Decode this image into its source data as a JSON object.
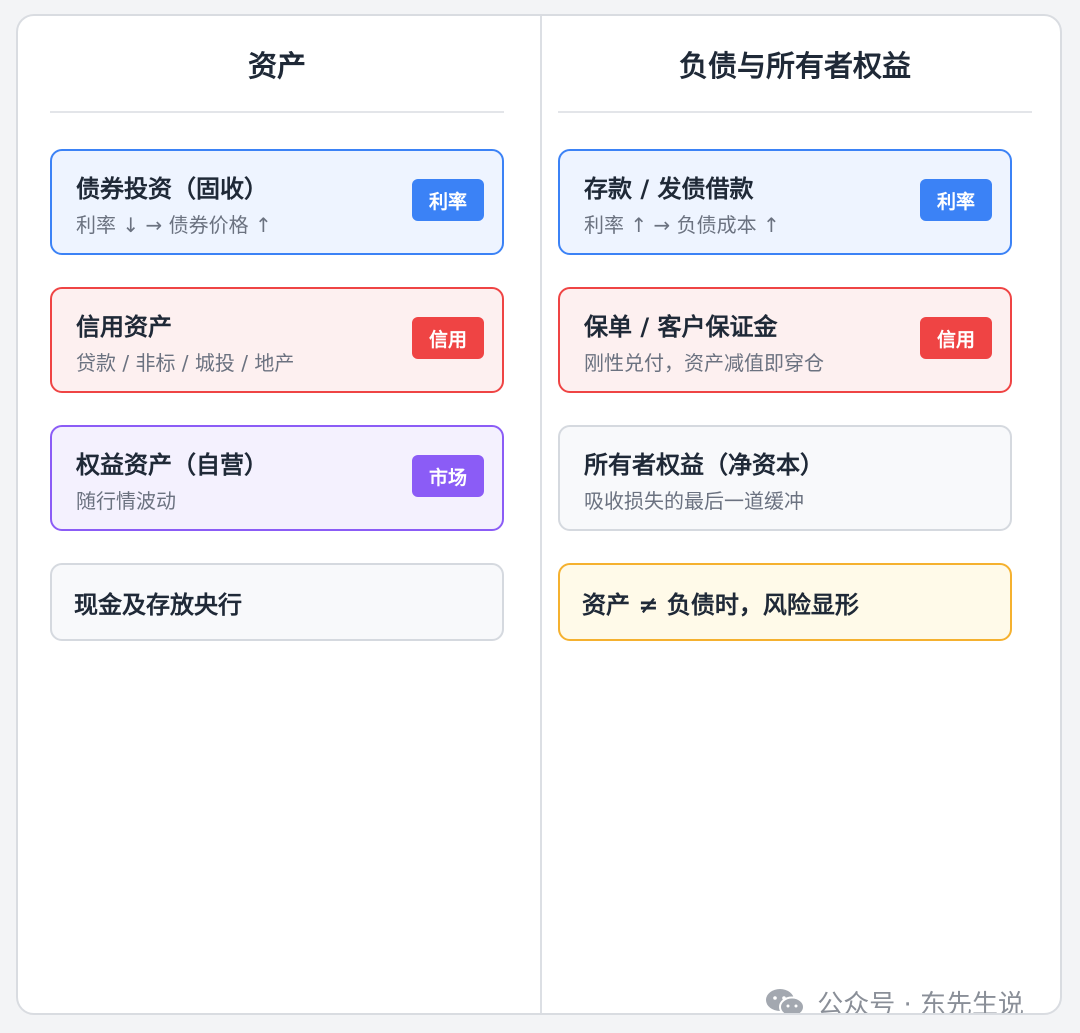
{
  "left": {
    "header": "资产",
    "cards": [
      {
        "title": "债券投资（固收）",
        "sub": "利率 ↓ → 债券价格 ↑",
        "badge": "利率"
      },
      {
        "title": "信用资产",
        "sub": "贷款 / 非标 / 城投 / 地产",
        "badge": "信用"
      },
      {
        "title": "权益资产（自营）",
        "sub": "随行情波动",
        "badge": "市场"
      },
      {
        "title": "现金及存放央行"
      }
    ]
  },
  "right": {
    "header": "负债与所有者权益",
    "cards": [
      {
        "title": "存款 / 发债借款",
        "sub": "利率 ↑ → 负债成本 ↑",
        "badge": "利率"
      },
      {
        "title": "保单 / 客户保证金",
        "sub": "刚性兑付，资产减值即穿仓",
        "badge": "信用"
      },
      {
        "title": "所有者权益（净资本）",
        "sub": "吸收损失的最后一道缓冲"
      },
      {
        "title": "资产 ≠ 负债时，风险显形"
      }
    ]
  },
  "watermark": {
    "text": "公众号 · 东先生说",
    "icon": "wechat-icon"
  },
  "colors": {
    "rate": "#3b82f6",
    "credit": "#ef4444",
    "market": "#8b5cf6",
    "highlight": "#f5b12f",
    "neutral_border": "#d5d9df"
  }
}
